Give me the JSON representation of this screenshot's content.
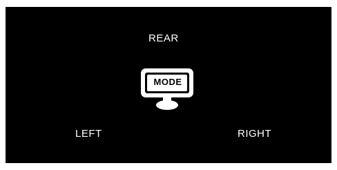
{
  "screen": {
    "labels": {
      "rear": "REAR",
      "left": "LEFT",
      "right": "RIGHT"
    },
    "center_icon": {
      "icon": "monitor-icon",
      "label": "MODE"
    }
  },
  "colors": {
    "background": "#000000",
    "foreground": "#ffffff"
  }
}
